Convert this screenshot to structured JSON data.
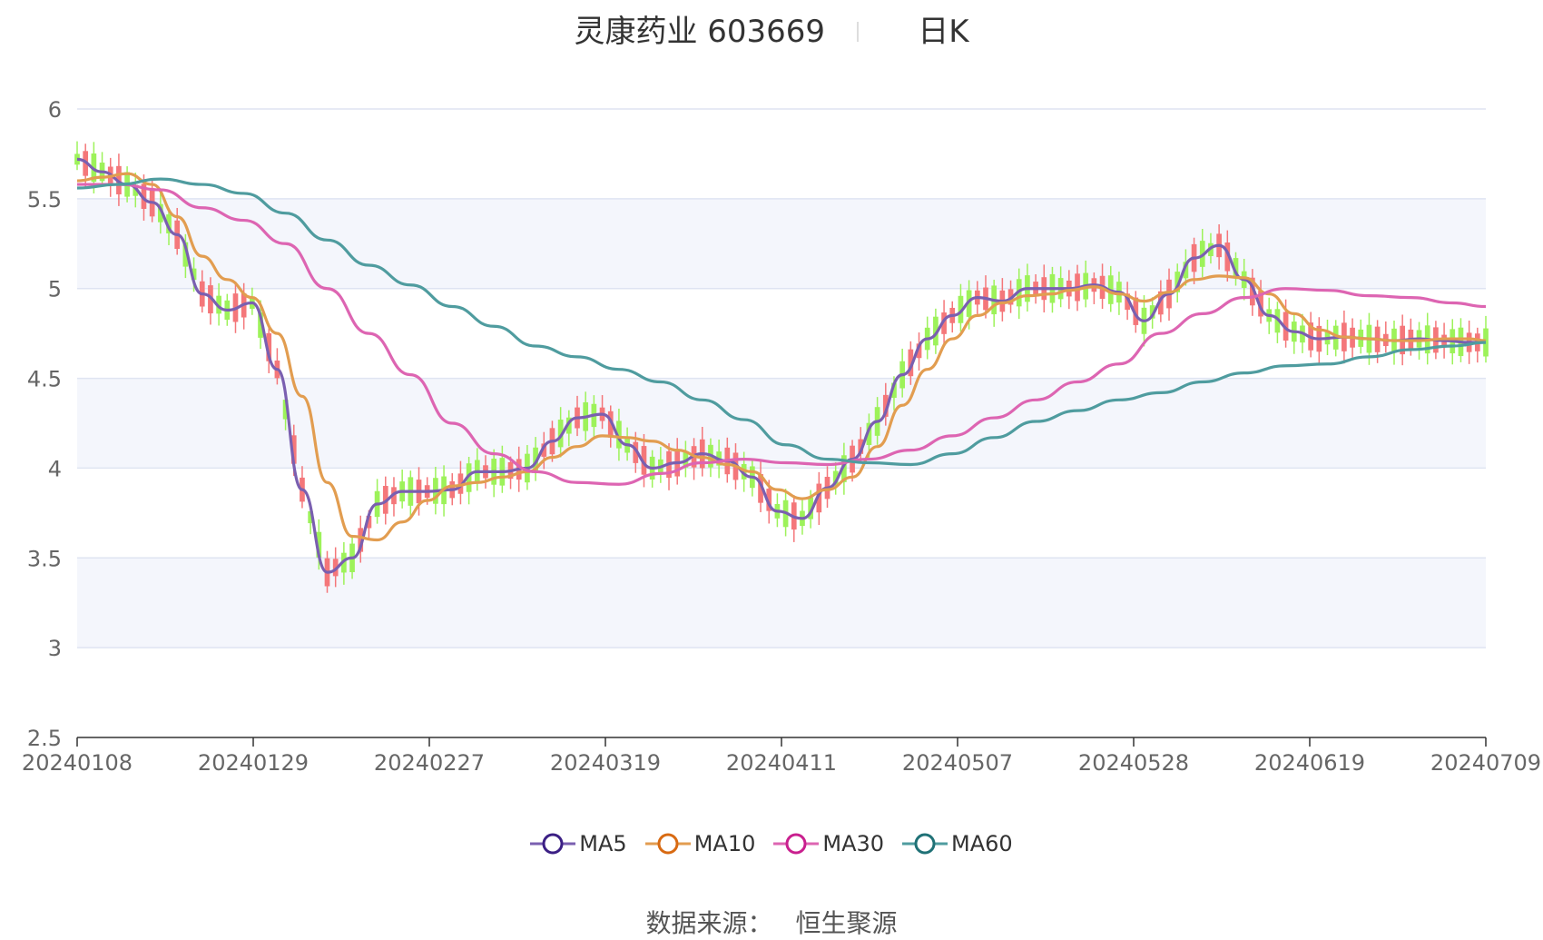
{
  "header": {
    "title": "灵康药业 603669",
    "subtitle": "日K"
  },
  "source": {
    "label": "数据来源：",
    "value": "恒生聚源"
  },
  "chart_data": {
    "type": "candlestick",
    "y_ticks": [
      "2.5",
      "3",
      "3.5",
      "4",
      "4.5",
      "5",
      "5.5",
      "6"
    ],
    "ylim": [
      2.5,
      6
    ],
    "x_ticks": [
      "20240108",
      "20240129",
      "20240227",
      "20240319",
      "20240411",
      "20240507",
      "20240528",
      "20240619",
      "20240709"
    ],
    "colors": {
      "up": "#f4777a",
      "down": "#9df25a",
      "band": "#f4f6fc",
      "grid": "#dfe4f2",
      "axis": "#333333"
    },
    "series": [
      {
        "name": "MA5",
        "color": "#7a5fb0",
        "marker": "#3b1f84",
        "x": [
          0,
          3,
          6,
          9,
          12,
          15,
          18,
          21,
          24,
          27,
          30,
          33,
          36,
          39,
          42,
          45,
          48,
          51,
          54,
          57,
          60,
          63,
          66,
          69,
          72,
          75,
          78,
          81,
          84,
          87,
          90,
          93,
          96,
          99,
          102,
          105,
          108,
          111,
          114,
          117,
          119,
          122,
          125,
          128,
          131,
          134,
          137,
          140,
          143,
          146,
          149,
          152,
          155,
          158,
          161,
          164,
          167,
          169
        ],
        "values": [
          5.72,
          5.65,
          5.58,
          5.48,
          5.3,
          4.97,
          4.88,
          4.92,
          4.55,
          3.88,
          3.42,
          3.5,
          3.8,
          3.87,
          3.87,
          3.88,
          3.98,
          3.98,
          4.0,
          4.15,
          4.28,
          4.3,
          4.13,
          4.0,
          4.03,
          4.08,
          4.04,
          3.95,
          3.76,
          3.72,
          3.89,
          4.05,
          4.26,
          4.52,
          4.72,
          4.85,
          4.95,
          4.93,
          5.0,
          5.0,
          5.0,
          5.02,
          4.98,
          4.82,
          4.97,
          5.17,
          5.24,
          5.05,
          4.85,
          4.76,
          4.72,
          4.73,
          4.72,
          4.71,
          4.72,
          4.71,
          4.7,
          4.7
        ]
      },
      {
        "name": "MA10",
        "color": "#e29d50",
        "marker": "#d86a12",
        "x": [
          0,
          3,
          6,
          9,
          12,
          15,
          18,
          21,
          24,
          27,
          30,
          33,
          36,
          39,
          42,
          45,
          48,
          51,
          54,
          57,
          60,
          63,
          66,
          69,
          72,
          75,
          78,
          81,
          84,
          87,
          90,
          93,
          96,
          99,
          102,
          105,
          108,
          111,
          114,
          117,
          119,
          122,
          125,
          128,
          131,
          134,
          137,
          140,
          143,
          146,
          149,
          152,
          155,
          158,
          161,
          164,
          167,
          169
        ],
        "values": [
          5.6,
          5.62,
          5.64,
          5.58,
          5.4,
          5.18,
          5.05,
          4.95,
          4.75,
          4.4,
          3.92,
          3.62,
          3.6,
          3.7,
          3.82,
          3.9,
          3.92,
          3.95,
          3.98,
          4.06,
          4.12,
          4.18,
          4.17,
          4.15,
          4.1,
          4.06,
          4.02,
          3.98,
          3.88,
          3.83,
          3.88,
          3.95,
          4.12,
          4.35,
          4.55,
          4.72,
          4.85,
          4.92,
          4.96,
          4.97,
          4.99,
          5.01,
          4.97,
          4.93,
          4.98,
          5.05,
          5.07,
          5.06,
          4.97,
          4.86,
          4.77,
          4.73,
          4.72,
          4.71,
          4.71,
          4.72,
          4.72,
          4.71
        ]
      },
      {
        "name": "MA30",
        "color": "#dd65b2",
        "marker": "#c91f8e",
        "x": [
          0,
          5,
          10,
          15,
          20,
          25,
          30,
          35,
          40,
          45,
          50,
          55,
          60,
          65,
          70,
          75,
          80,
          85,
          90,
          95,
          100,
          105,
          110,
          115,
          120,
          125,
          130,
          135,
          140,
          145,
          150,
          155,
          160,
          165,
          169
        ],
        "values": [
          5.58,
          5.58,
          5.55,
          5.45,
          5.38,
          5.25,
          5.0,
          4.75,
          4.52,
          4.25,
          4.08,
          3.98,
          3.92,
          3.91,
          3.97,
          4.03,
          4.05,
          4.03,
          4.02,
          4.05,
          4.1,
          4.18,
          4.28,
          4.38,
          4.48,
          4.58,
          4.75,
          4.86,
          4.95,
          5.0,
          4.99,
          4.96,
          4.95,
          4.92,
          4.9
        ]
      },
      {
        "name": "MA60",
        "color": "#4f9c9f",
        "marker": "#1f7176",
        "x": [
          0,
          5,
          10,
          15,
          20,
          25,
          30,
          35,
          40,
          45,
          50,
          55,
          60,
          65,
          70,
          75,
          80,
          85,
          90,
          95,
          100,
          105,
          110,
          115,
          120,
          125,
          130,
          135,
          140,
          145,
          150,
          155,
          160,
          165,
          169
        ],
        "values": [
          5.56,
          5.58,
          5.61,
          5.58,
          5.53,
          5.42,
          5.27,
          5.13,
          5.02,
          4.9,
          4.79,
          4.68,
          4.62,
          4.55,
          4.48,
          4.38,
          4.27,
          4.13,
          4.05,
          4.03,
          4.02,
          4.08,
          4.17,
          4.26,
          4.32,
          4.38,
          4.42,
          4.48,
          4.53,
          4.57,
          4.58,
          4.62,
          4.66,
          4.68,
          4.7
        ]
      }
    ]
  }
}
